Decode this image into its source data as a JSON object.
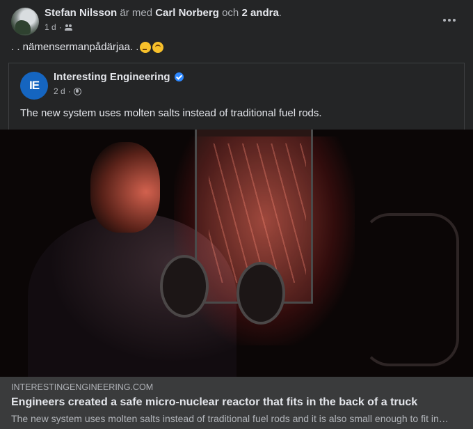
{
  "post": {
    "author": "Stefan Nilsson",
    "with_text": "är med",
    "tagged": "Carl Norberg",
    "and_text": "och",
    "others": "2 andra",
    "period": ".",
    "time": "1 d",
    "dot": "·",
    "audience_icon": "friends-icon",
    "text": ". . nämensermanpådärjaa. .",
    "emojis": [
      "thinking-face-emoji",
      "upside-down-face-emoji"
    ]
  },
  "shared": {
    "page_name": "Interesting Engineering",
    "logo_text": "IE",
    "time": "2 d",
    "dot": "·",
    "audience_icon": "globe-icon",
    "text": "The new system uses molten salts instead of traditional fuel rods."
  },
  "link": {
    "domain": "INTERESTINGENGINEERING.COM",
    "title": "Engineers created a safe micro-nuclear reactor that fits in the back of a truck",
    "description": "The new system uses molten salts instead of traditional fuel rods and it is also small enough to fit in the back of a truck."
  },
  "colors": {
    "background": "#242526",
    "link_box": "#3a3b3c",
    "accent": "#2d88ff",
    "logo": "#1565c0"
  }
}
